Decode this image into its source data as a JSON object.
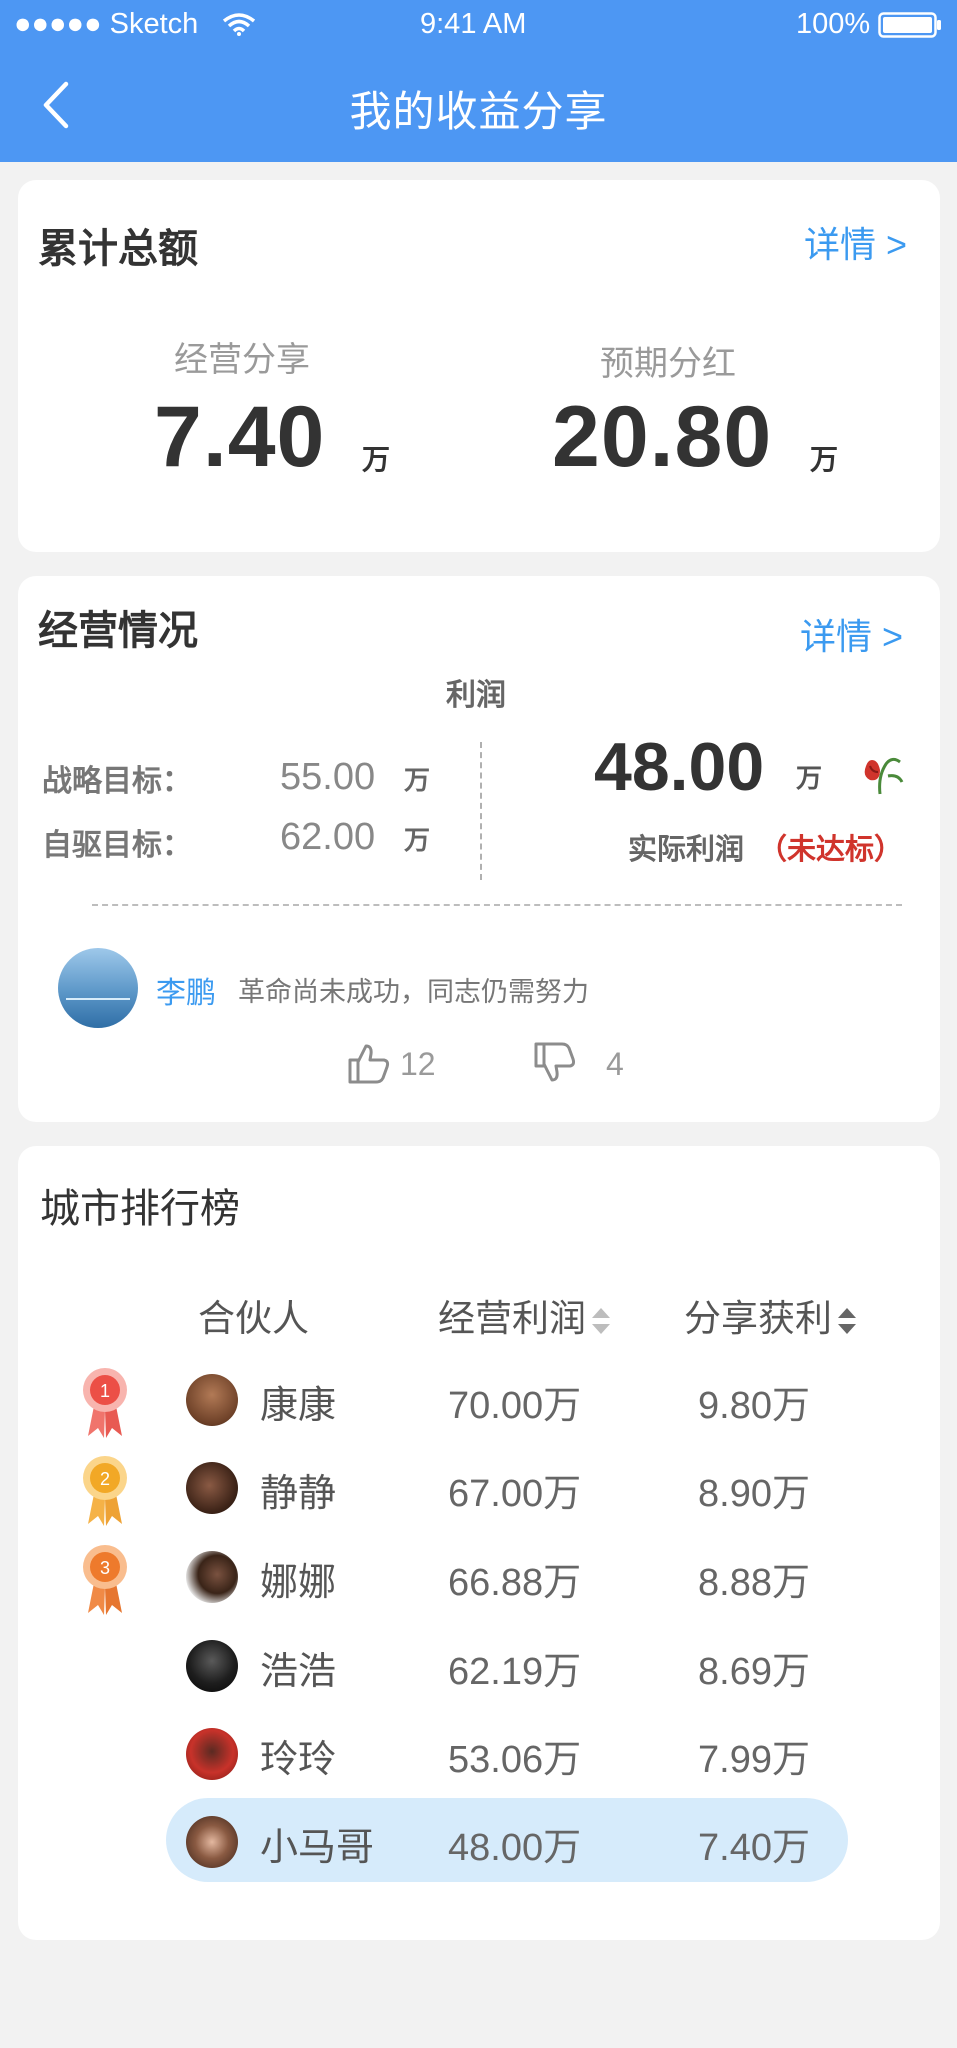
{
  "status_bar": {
    "signal_carrier": "●●●●● Sketch",
    "time": "9:41 AM",
    "battery": "100%"
  },
  "header": {
    "title": "我的收益分享"
  },
  "total": {
    "title": "累计总额",
    "detail": "详情 >",
    "business_share": {
      "label": "经营分享",
      "value": "7.40",
      "unit": "万"
    },
    "expected_dividend": {
      "label": "预期分红",
      "value": "20.80",
      "unit": "万"
    }
  },
  "operation": {
    "title": "经营情况",
    "detail": "详情 >",
    "profit_label": "利润",
    "strategic": {
      "label": "战略目标：",
      "value": "55.00",
      "unit": "万"
    },
    "self_driven": {
      "label": "自驱目标：",
      "value": "62.00",
      "unit": "万"
    },
    "actual": {
      "value": "48.00",
      "unit": "万",
      "label": "实际利润",
      "status": "（未达标）"
    },
    "comment": {
      "user": "李鹏",
      "text": "革命尚未成功，同志仍需努力"
    },
    "likes": "12",
    "dislikes": "4",
    "colors": {
      "accent": "#3b9af0",
      "warning": "#d0342c",
      "header": "#4d97f3"
    }
  },
  "ranking": {
    "title": "城市排行榜",
    "columns": {
      "partner": "合伙人",
      "profit": "经营利润",
      "share": "分享获利"
    },
    "rows": [
      {
        "name": "康康",
        "profit": "70.00万",
        "share": "9.80万",
        "medal": "1"
      },
      {
        "name": "静静",
        "profit": "67.00万",
        "share": "8.90万",
        "medal": "2"
      },
      {
        "name": "娜娜",
        "profit": "66.88万",
        "share": "8.88万",
        "medal": "3"
      },
      {
        "name": "浩浩",
        "profit": "62.19万",
        "share": "8.69万"
      },
      {
        "name": "玲玲",
        "profit": "53.06万",
        "share": "7.99万"
      },
      {
        "name": "小马哥",
        "profit": "48.00万",
        "share": "7.40万",
        "highlight": true
      }
    ]
  }
}
